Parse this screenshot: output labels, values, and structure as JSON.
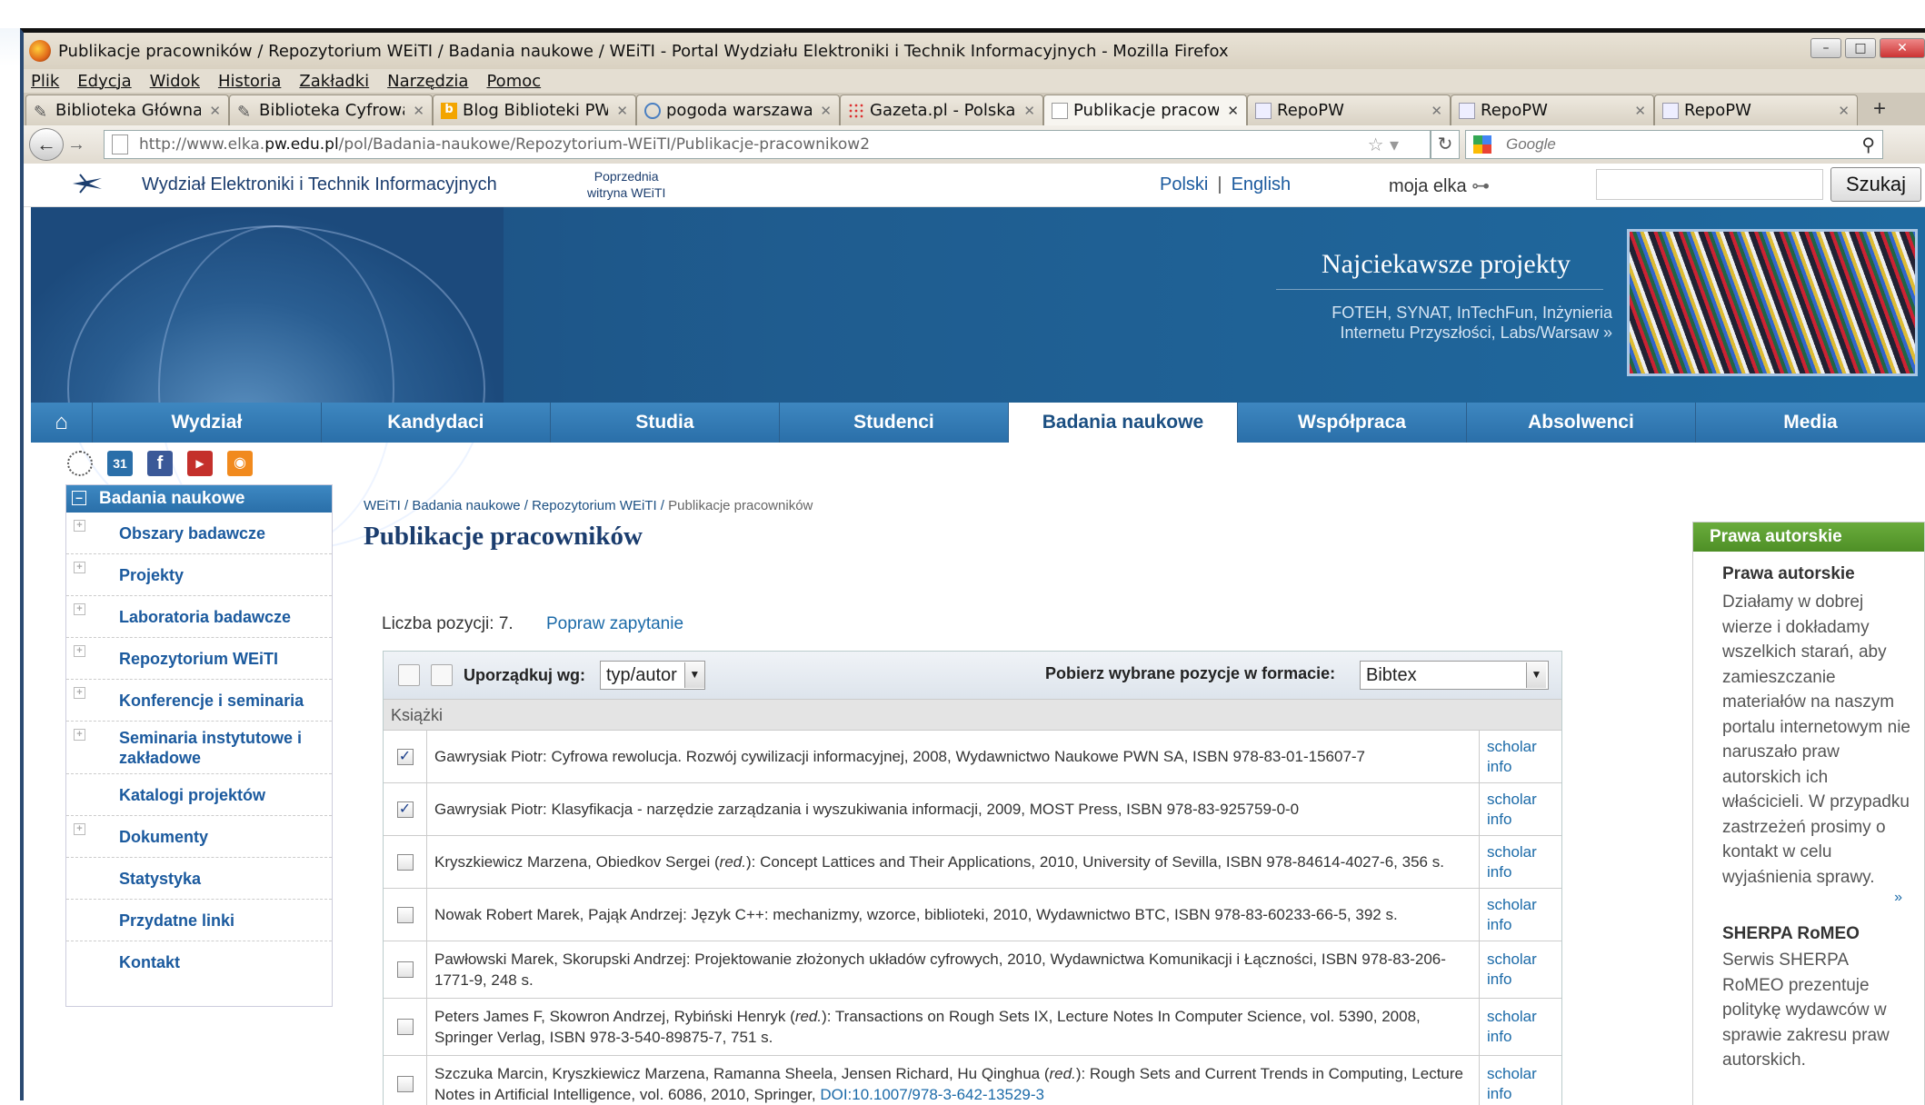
{
  "browser": {
    "title": "Publikacje pracowników / Repozytorium WEiTI / Badania naukowe / WEiTI - Portal Wydziału Elektroniki i Technik Informacyjnych - Mozilla Firefox",
    "menu": [
      "Plik",
      "Edycja",
      "Widok",
      "Historia",
      "Zakładki",
      "Narzędzia",
      "Pomoc"
    ],
    "tabs": [
      {
        "label": "Biblioteka Główna ...",
        "active": false
      },
      {
        "label": "Biblioteka Cyfrowa...",
        "active": false
      },
      {
        "label": "Blog Biblioteki PW",
        "active": false
      },
      {
        "label": "pogoda warszawa ...",
        "active": false
      },
      {
        "label": "Gazeta.pl - Polska i...",
        "active": false
      },
      {
        "label": "Publikacje pracow...",
        "active": true
      },
      {
        "label": "RepoPW",
        "active": false
      },
      {
        "label": "RepoPW",
        "active": false
      },
      {
        "label": "RepoPW",
        "active": false
      }
    ],
    "url_prefix": "http://www.elka.",
    "url_domain": "pw.edu.pl",
    "url_path": "/pol/Badania-naukowe/Repozytorium-WEiTI/Publikacje-pracownikow2",
    "search_placeholder": "Google"
  },
  "site": {
    "name": "Wydział Elektroniki i Technik Informacyjnych",
    "prev_site_line1": "Poprzednia",
    "prev_site_line2": "witryna WEiTI",
    "lang_pl": "Polski",
    "lang_sep": "|",
    "lang_en": "English",
    "moja": "moja elka",
    "search_button": "Szukaj"
  },
  "hero": {
    "title": "Najciekawsze projekty",
    "subtitle": "FOTEH, SYNAT, InTechFun, Inżynieria Internetu Przyszłości, Labs/Warsaw »"
  },
  "mainnav": [
    "Wydział",
    "Kandydaci",
    "Studia",
    "Studenci",
    "Badania naukowe",
    "Współpraca",
    "Absolwenci",
    "Media"
  ],
  "mainnav_active": "Badania naukowe",
  "sidebar": {
    "heading": "Badania naukowe",
    "items": [
      {
        "label": "Obszary badawcze",
        "expandable": true
      },
      {
        "label": "Projekty",
        "expandable": true
      },
      {
        "label": "Laboratoria badawcze",
        "expandable": true
      },
      {
        "label": "Repozytorium WEiTI",
        "expandable": true
      },
      {
        "label": "Konferencje i seminaria",
        "expandable": true
      },
      {
        "label": "Seminaria instytutowe i zakładowe",
        "expandable": true
      },
      {
        "label": "Katalogi projektów",
        "expandable": false
      },
      {
        "label": "Dokumenty",
        "expandable": true
      },
      {
        "label": "Statystyka",
        "expandable": false
      },
      {
        "label": "Przydatne linki",
        "expandable": false
      },
      {
        "label": "Kontakt",
        "expandable": false
      }
    ]
  },
  "breadcrumb": {
    "trail": "WEiTI / Badania naukowe / Repozytorium WEiTI /",
    "current": "Publikacje pracowników"
  },
  "main": {
    "title": "Publikacje pracowników",
    "count_label": "Liczba pozycji: 7.",
    "popraw": "Popraw zapytanie",
    "sort_label": "Uporządkuj wg:",
    "sort_value": "typ/autor",
    "format_label": "Pobierz wybrane pozycje w formacie:",
    "format_value": "Bibtex",
    "group": "Książki",
    "scholar_line1": "scholar",
    "scholar_line2": "info",
    "rows": [
      {
        "checked": true,
        "pre": "Gawrysiak Piotr: Cyfrowa rewolucja. Rozwój cywilizacji informacyjnej, 2008, Wydawnictwo Naukowe PWN SA, ISBN 978-83-01-15607-7",
        "red": "",
        "post": "",
        "doi": ""
      },
      {
        "checked": true,
        "pre": "Gawrysiak Piotr: Klasyfikacja - narzędzie zarządzania i wyszukiwania informacji, 2009, MOST Press, ISBN 978-83-925759-0-0",
        "red": "",
        "post": "",
        "doi": ""
      },
      {
        "checked": false,
        "pre": "Kryszkiewicz Marzena, Obiedkov Sergei (",
        "red": "red.",
        "post": "): Concept Lattices and Their Applications, 2010, University of Sevilla, ISBN 978-84614-4027-6, 356 s.",
        "doi": ""
      },
      {
        "checked": false,
        "pre": "Nowak Robert Marek, Pająk Andrzej: Język C++: mechanizmy, wzorce, biblioteki, 2010, Wydawnictwo BTC, ISBN 978-83-60233-66-5, 392 s.",
        "red": "",
        "post": "",
        "doi": ""
      },
      {
        "checked": false,
        "pre": "Pawłowski Marek, Skorupski Andrzej: Projektowanie złożonych układów cyfrowych, 2010, Wydawnictwa Komunikacji i Łączności, ISBN 978-83-206-1771-9, 248 s.",
        "red": "",
        "post": "",
        "doi": ""
      },
      {
        "checked": false,
        "pre": "Peters James F, Skowron Andrzej, Rybiński Henryk (",
        "red": "red.",
        "post": "): Transactions on Rough Sets IX, Lecture Notes In Computer Science, vol. 5390, 2008, Springer Verlag, ISBN 978-3-540-89875-7, 751 s.",
        "doi": ""
      },
      {
        "checked": false,
        "pre": "Szczuka Marcin, Kryszkiewicz Marzena, Ramanna Sheela, Jensen Richard, Hu Qinghua (",
        "red": "red.",
        "post": "): Rough Sets and Current Trends in Computing, Lecture Notes in Artificial Intelligence, vol. 6086, 2010, Springer, ",
        "doi": "DOI:10.1007/978-3-642-13529-3"
      }
    ]
  },
  "pager": [
    "««",
    "«",
    "",
    "",
    "»",
    "»»"
  ],
  "right": {
    "heading": "Prawa autorskie",
    "title1": "Prawa autorskie",
    "text1": "Działamy w dobrej wierze i dokładamy wszelkich starań, aby zamieszczanie materiałów na naszym portalu internetowym nie naruszało praw autorskich ich właścicieli. W przypadku zastrzeżeń prosimy o kontakt w celu wyjaśnienia sprawy.",
    "more": "»",
    "title2": "SHERPA RoMEO",
    "text2": "Serwis SHERPA RoMEO prezentuje politykę wydawców w sprawie zakresu praw autorskich."
  },
  "colors": {
    "nav_blue": "#2a6fa9",
    "link": "#1b6aa8",
    "green_head": "#4e8f26",
    "title_blue": "#1b3d6e"
  }
}
